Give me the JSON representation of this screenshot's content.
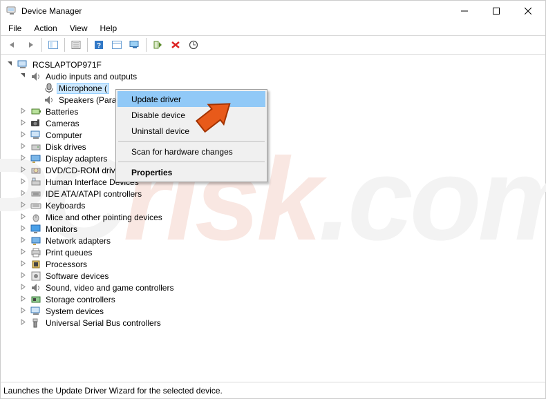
{
  "window": {
    "title": "Device Manager"
  },
  "menu": {
    "file": "File",
    "action": "Action",
    "view": "View",
    "help": "Help"
  },
  "tree": {
    "root": "RCSLAPTOP971F",
    "audio_outputs": "Audio inputs and outputs",
    "microphone": "Microphone (",
    "speakers": "Speakers (Para",
    "batteries": "Batteries",
    "cameras": "Cameras",
    "computer": "Computer",
    "disk_drives": "Disk drives",
    "display_adapters": "Display adapters",
    "dvd": "DVD/CD-ROM drives",
    "hid": "Human Interface Devices",
    "ide": "IDE ATA/ATAPI controllers",
    "keyboards": "Keyboards",
    "mice": "Mice and other pointing devices",
    "monitors": "Monitors",
    "network": "Network adapters",
    "print_queues": "Print queues",
    "processors": "Processors",
    "software_devices": "Software devices",
    "sound": "Sound, video and game controllers",
    "storage": "Storage controllers",
    "system_devices": "System devices",
    "usb": "Universal Serial Bus controllers"
  },
  "context_menu": {
    "update_driver": "Update driver",
    "disable_device": "Disable device",
    "uninstall_device": "Uninstall device",
    "scan": "Scan for hardware changes",
    "properties": "Properties"
  },
  "status": "Launches the Update Driver Wizard for the selected device."
}
